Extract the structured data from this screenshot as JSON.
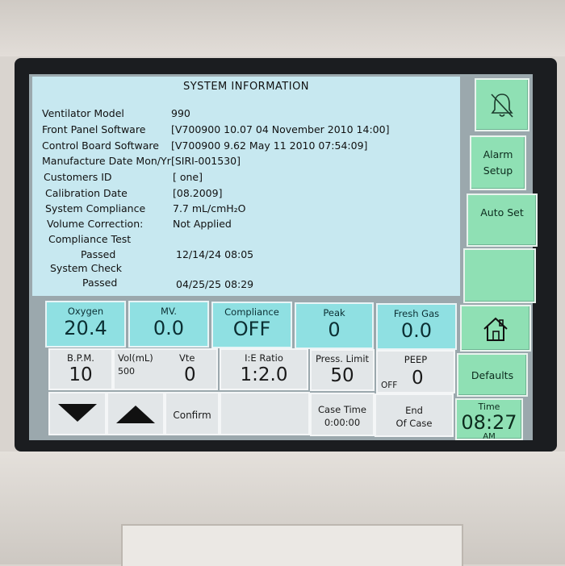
{
  "header": {
    "title": "SYSTEM INFORMATION"
  },
  "info_rows": [
    {
      "label": "Ventilator Model",
      "value": "990"
    },
    {
      "label": "Front Panel Software",
      "value": "[V700900 10.07 04 November 2010 14:00]"
    },
    {
      "label": "Control Board Software",
      "value": "[V700900 9.62  May 11 2010 07:54:09]"
    },
    {
      "label": "Manufacture Date Mon/Yr",
      "value": "[SIRI-001530]"
    },
    {
      "label": "Customers ID",
      "value": "[ one]"
    },
    {
      "label": "Calibration Date",
      "value": "[08.2009]"
    },
    {
      "label": "System Compliance",
      "value": "7.7  mL/cmH₂O"
    },
    {
      "label": "Volume Correction:",
      "value": "Not Applied"
    }
  ],
  "checks": {
    "compliance_label": "Compliance Test",
    "compliance_status": "Passed",
    "compliance_time": "12/14/24  08:05",
    "system_label": "System Check",
    "system_status": "Passed",
    "system_time": "04/25/25  08:29"
  },
  "right_panel": {
    "alarm_silence_icon": "bell-crossed-icon",
    "alarm_setup_line1": "Alarm",
    "alarm_setup_line2": "Setup",
    "auto_set": "Auto Set",
    "home_icon": "home-icon",
    "defaults": "Defaults",
    "time_label": "Time",
    "time_value": "08:27",
    "time_ampm": "AM"
  },
  "params": [
    {
      "label": "Oxygen",
      "value": "20.4"
    },
    {
      "label": "MV.",
      "value": "0.0"
    },
    {
      "label": "Compliance",
      "value": "OFF"
    },
    {
      "label": "Peak",
      "value": "0"
    },
    {
      "label": "Fresh Gas",
      "value": "0.0"
    }
  ],
  "settings": {
    "bpm_label": "B.P.M.",
    "bpm_value": "10",
    "vol_label": "Vol(mL)",
    "vol_value": "500",
    "vte_label": "Vte",
    "vte_value": "0",
    "ie_label": "I:E Ratio",
    "ie_value": "1:2.0",
    "press_label": "Press. Limit",
    "press_value": "50",
    "peep_label": "PEEP",
    "peep_value": "0",
    "peep_off": "OFF"
  },
  "bottom": {
    "down_icon": "arrow-down-icon",
    "up_icon": "arrow-up-icon",
    "confirm": "Confirm",
    "case_time_label": "Case Time",
    "case_time_value": "0:00:00",
    "end_case_line1": "End",
    "end_case_line2": "Of Case"
  },
  "colors": {
    "info_bg": "#c7e8f0",
    "param_bg": "#8fe0e2",
    "button_green": "#8fe0b4",
    "setting_bg": "#e2e6e8"
  }
}
